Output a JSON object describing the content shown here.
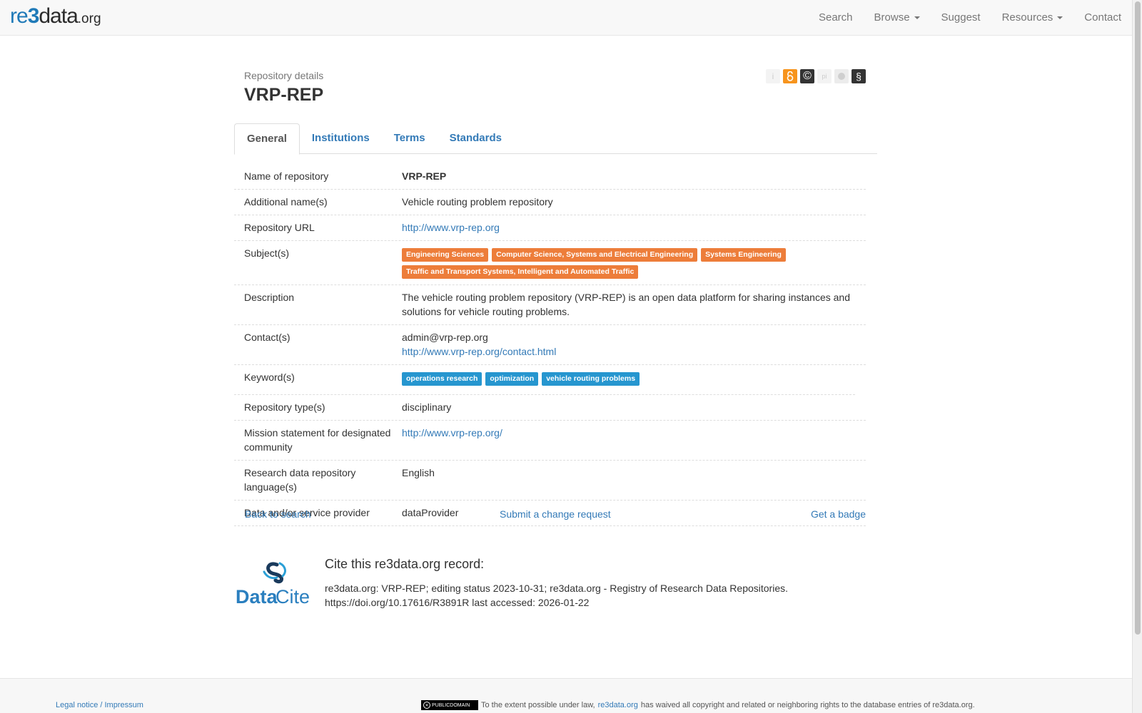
{
  "brand": {
    "part1": "re",
    "part2": "3",
    "part3": "data",
    "part4": ".org"
  },
  "nav": {
    "search": "Search",
    "browse": "Browse",
    "suggest": "Suggest",
    "resources": "Resources",
    "contact": "Contact"
  },
  "header": {
    "subtitle": "Repository details",
    "title": "VRP-REP"
  },
  "badge_icons": [
    "info-icon",
    "open-access-icon",
    "copyright-icon",
    "pid-icon",
    "certificate-icon",
    "policy-icon"
  ],
  "badge_glyphs": {
    "info": "i",
    "open_access": "a",
    "copyright": "©",
    "pid": "pi",
    "policy": "§"
  },
  "tabs": {
    "general": "General",
    "institutions": "Institutions",
    "terms": "Terms",
    "standards": "Standards"
  },
  "details": {
    "name": {
      "label": "Name of repository",
      "value": "VRP-REP"
    },
    "additional_names": {
      "label": "Additional name(s)",
      "value": "Vehicle routing problem repository"
    },
    "url": {
      "label": "Repository URL",
      "value": "http://www.vrp-rep.org"
    },
    "subjects": {
      "label": "Subject(s)",
      "items": [
        "Engineering Sciences",
        "Computer Science, Systems and Electrical Engineering",
        "Systems Engineering",
        "Traffic and Transport Systems, Intelligent and Automated Traffic"
      ]
    },
    "description": {
      "label": "Description",
      "value": "The vehicle routing problem repository (VRP-REP) is an open data platform for sharing instances and solutions for vehicle routing problems."
    },
    "contacts": {
      "label": "Contact(s)",
      "email": "admin@vrp-rep.org",
      "link": "http://www.vrp-rep.org/contact.html"
    },
    "keywords": {
      "label": "Keyword(s)",
      "items": [
        "operations research",
        "optimization",
        "vehicle routing problems"
      ]
    },
    "repo_type": {
      "label": "Repository type(s)",
      "value": "disciplinary"
    },
    "mission": {
      "label": "Mission statement for designated community",
      "value": "http://www.vrp-rep.org/"
    },
    "language": {
      "label": "Research data repository language(s)",
      "value": "English"
    },
    "provider": {
      "label": "Data and/or service provider",
      "value": "dataProvider"
    }
  },
  "actions": {
    "back": "Back to search",
    "change": "Submit a change request",
    "badge": "Get a badge"
  },
  "datacite": {
    "logo_text1": "Data",
    "logo_text2": "Cite"
  },
  "cite": {
    "title": "Cite this re3data.org record:",
    "text": "re3data.org: VRP-REP; editing status 2023-10-31; re3data.org - Registry of Research Data Repositories. https://doi.org/10.17616/R3891R last accessed: 2026-01-22"
  },
  "footer": {
    "legal": "Legal notice / Impressum",
    "cc_label": "PUBLICDOMAIN",
    "license_pre": "To the extent possible under law,",
    "license_link": "re3data.org",
    "license_post": "has waived all copyright and related or neighboring rights to the database entries of re3data.org."
  },
  "colors": {
    "link": "#337ab7",
    "subject_tag": "#ed7d3a",
    "keyword_tag": "#2696cf",
    "open_access": "#f7941d"
  }
}
